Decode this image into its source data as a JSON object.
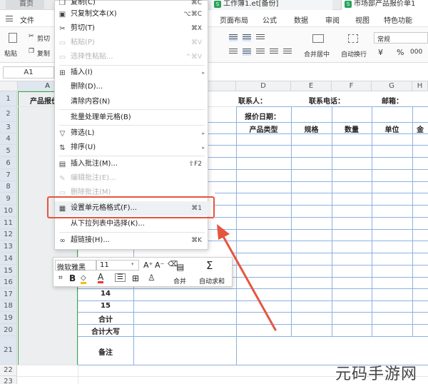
{
  "tabs": {
    "home": "首页",
    "doc1": "工作簿1.et[备份]",
    "doc2": "市场部产品报价单1"
  },
  "menu": {
    "file": "文件",
    "page_layout": "页面布局",
    "formula": "公式",
    "data": "数据",
    "review": "审阅",
    "view": "视图",
    "special": "特色功能"
  },
  "ribbon": {
    "paste": "粘贴",
    "cut": "剪切",
    "copy": "复制",
    "merge_center": "合并居中",
    "wrap_text": "自动换行",
    "number_format": "常规",
    "currency": "¥",
    "percent": "%",
    "thousands": "000"
  },
  "formula_bar": {
    "name_box": "A1"
  },
  "columns": [
    "A",
    "B",
    "C",
    "D",
    "E",
    "F",
    "G",
    "H"
  ],
  "rows": [
    "1",
    "2",
    "3",
    "4",
    "5",
    "6",
    "7",
    "8",
    "9",
    "10",
    "11",
    "12",
    "13",
    "14",
    "15",
    "16",
    "17",
    "18",
    "19",
    "20",
    "21",
    "22",
    "23"
  ],
  "cells": {
    "a1": "产品报价",
    "d1": "联系人：",
    "e1": "联系电话：",
    "g1": "邮箱：",
    "d2": "报价日期：",
    "d3": "产品类型",
    "e3": "规格",
    "f3": "数量",
    "g3": "单位",
    "h3": "金",
    "b17": "14",
    "b18": "15",
    "b19": "合计",
    "b20": "合计大写",
    "b21": "备注",
    "b16_partial": "13"
  },
  "context_menu": {
    "items": [
      {
        "label": "复制(C)",
        "shortcut": "⌘C",
        "icon": "copy-icon"
      },
      {
        "label": "只复制文本(X)",
        "shortcut": "⌥⌘C",
        "icon": "copy-text-icon"
      },
      {
        "label": "剪切(T)",
        "shortcut": "⌘X",
        "icon": "scissors-icon"
      },
      {
        "label": "粘贴(P)",
        "shortcut": "⌘V",
        "icon": "paste-icon"
      },
      {
        "label": "选择性粘贴...",
        "shortcut": "^⌘V",
        "icon": "paste-special-icon"
      },
      {
        "label": "插入(I)",
        "shortcut": "",
        "icon": "insert-icon"
      },
      {
        "label": "删除(D)...",
        "shortcut": "",
        "icon": ""
      },
      {
        "label": "清除内容(N)",
        "shortcut": "",
        "icon": ""
      },
      {
        "label": "批量处理单元格(B)",
        "shortcut": "",
        "icon": ""
      },
      {
        "label": "筛选(L)",
        "shortcut": "",
        "icon": "filter-icon"
      },
      {
        "label": "排序(U)",
        "shortcut": "",
        "icon": "sort-icon"
      },
      {
        "label": "插入批注(M)...",
        "shortcut": "⇧F2",
        "icon": "comment-icon"
      },
      {
        "label": "编辑批注(E)...",
        "shortcut": "",
        "icon": "edit-comment-icon"
      },
      {
        "label": "删除批注(M)",
        "shortcut": "",
        "icon": "delete-comment-icon"
      },
      {
        "label": "设置单元格格式(F)...",
        "shortcut": "⌘1",
        "icon": "format-cells-icon"
      },
      {
        "label": "从下拉列表中选择(K)...",
        "shortcut": "",
        "icon": ""
      },
      {
        "label": "超链接(H)...",
        "shortcut": "⌘K",
        "icon": "link-icon"
      }
    ]
  },
  "mini_toolbar": {
    "font": "微软雅黑",
    "size": "11",
    "grow": "A⁺",
    "shrink": "A⁻",
    "bold": "B",
    "font_color": "A",
    "merge": "合并",
    "autosum": "自动求和"
  },
  "watermark": "元码手游网"
}
